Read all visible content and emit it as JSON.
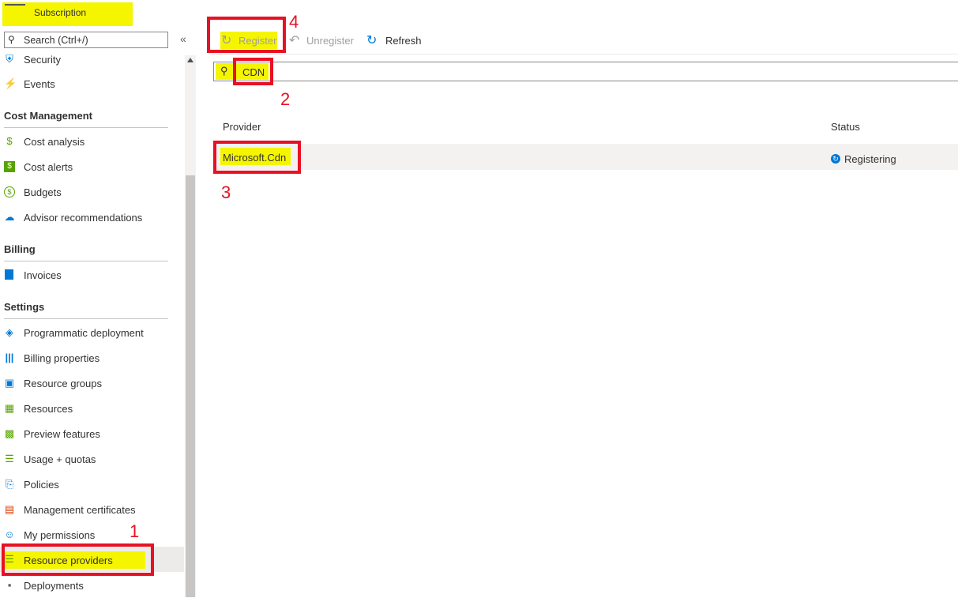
{
  "sidebar": {
    "title": "Subscription",
    "search_placeholder": "Search (Ctrl+/)",
    "collapse": "«",
    "top_items": [
      {
        "label": "Security",
        "icon": "shield-icon"
      },
      {
        "label": "Events",
        "icon": "lightning-icon"
      }
    ],
    "sections": [
      {
        "title": "Cost Management",
        "items": [
          {
            "label": "Cost analysis",
            "icon": "cost-analysis-icon"
          },
          {
            "label": "Cost alerts",
            "icon": "dollar-icon"
          },
          {
            "label": "Budgets",
            "icon": "budget-icon"
          },
          {
            "label": "Advisor recommendations",
            "icon": "cloud-icon"
          }
        ]
      },
      {
        "title": "Billing",
        "items": [
          {
            "label": "Invoices",
            "icon": "invoice-icon"
          }
        ]
      },
      {
        "title": "Settings",
        "items": [
          {
            "label": "Programmatic deployment",
            "icon": "bag-icon"
          },
          {
            "label": "Billing properties",
            "icon": "bars-icon"
          },
          {
            "label": "Resource groups",
            "icon": "cube-icon"
          },
          {
            "label": "Resources",
            "icon": "grid-icon"
          },
          {
            "label": "Preview features",
            "icon": "preview-icon"
          },
          {
            "label": "Usage + quotas",
            "icon": "list-icon"
          },
          {
            "label": "Policies",
            "icon": "policy-icon"
          },
          {
            "label": "Management certificates",
            "icon": "certificate-icon"
          },
          {
            "label": "My permissions",
            "icon": "person-icon"
          },
          {
            "label": "Resource providers",
            "icon": "checklist-icon"
          },
          {
            "label": "Deployments",
            "icon": "deploy-icon"
          }
        ]
      }
    ]
  },
  "toolbar": {
    "register": "Register",
    "unregister": "Unregister",
    "refresh": "Refresh"
  },
  "filter": {
    "value": "CDN"
  },
  "table": {
    "headers": [
      "Provider",
      "Status"
    ],
    "rows": [
      {
        "provider": "Microsoft.Cdn",
        "status": "Registering"
      }
    ]
  },
  "annotations": [
    "1",
    "2",
    "3",
    "4"
  ],
  "colors": {
    "highlight": "#f5f500",
    "annotation": "#e81123",
    "accent": "#0078d4"
  }
}
